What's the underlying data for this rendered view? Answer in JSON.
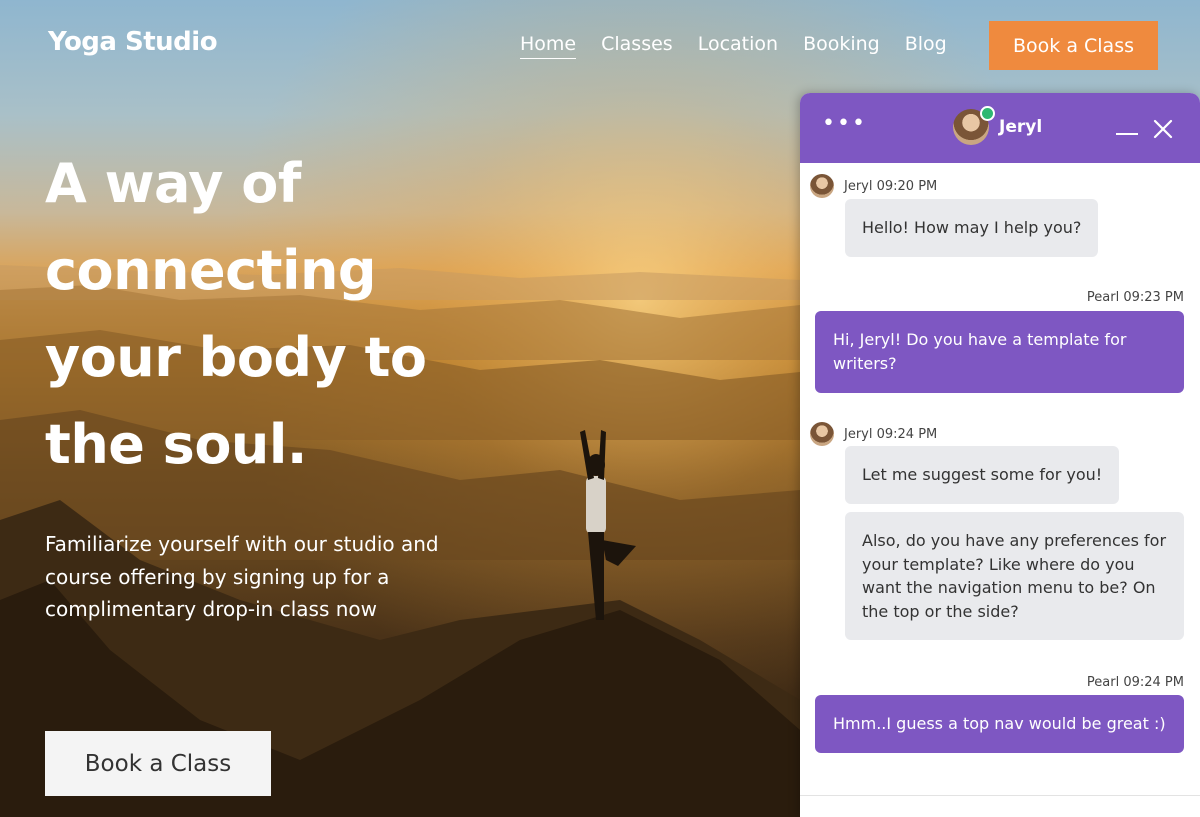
{
  "brand": {
    "name": "Yoga Studio",
    "accent": "#ef8a3e",
    "chat_accent": "#7e57c2"
  },
  "nav": {
    "items": [
      {
        "label": "Home",
        "active": true
      },
      {
        "label": "Classes",
        "active": false
      },
      {
        "label": "Location",
        "active": false
      },
      {
        "label": "Booking",
        "active": false
      },
      {
        "label": "Blog",
        "active": false
      }
    ],
    "cta": "Book a Class"
  },
  "hero": {
    "headline": "A way of connecting your body to the soul.",
    "subtext": "Familiarize yourself with our studio and course offering by signing up for a complimentary drop-in class now",
    "cta": "Book a Class"
  },
  "chat": {
    "agent": {
      "name": "Jeryl",
      "online": true
    },
    "icons": {
      "menu": "more-dots-icon",
      "minimize": "minimize-icon",
      "close": "close-icon"
    },
    "messages": [
      {
        "from": "agent",
        "meta": "Jeryl 09:20 PM",
        "texts": [
          "Hello! How may I help you?"
        ]
      },
      {
        "from": "user",
        "meta": "Pearl 09:23 PM",
        "texts": [
          "Hi, Jeryl! Do you have a template for writers?"
        ]
      },
      {
        "from": "agent",
        "meta": "Jeryl 09:24 PM",
        "texts": [
          "Let me suggest some for you!",
          "Also, do you have any preferences for your template? Like where do you want the navigation menu to be? On the top or the side?"
        ]
      },
      {
        "from": "user",
        "meta": "Pearl 09:24 PM",
        "texts": [
          "Hmm..I guess a top nav would be great :)"
        ]
      }
    ]
  }
}
